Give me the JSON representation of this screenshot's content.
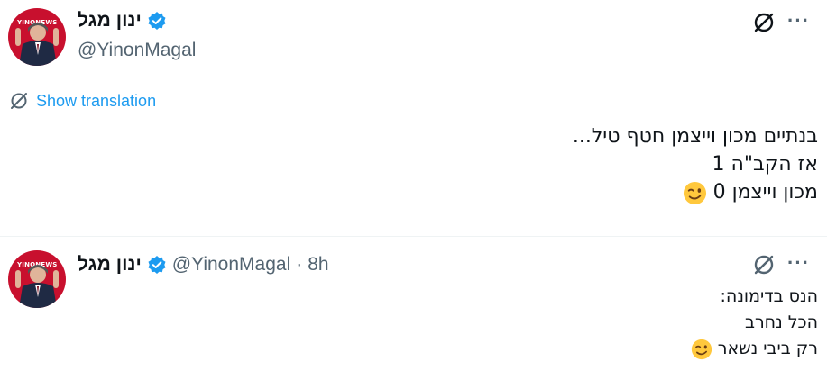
{
  "tweets": [
    {
      "display_name": "ינון מגל",
      "handle": "@YinonMagal",
      "avatar_tag": "YINONEWS",
      "more_label": "···",
      "translate_label": "Show translation",
      "lines": [
        "בנתיים מכון וייצמן חטף טיל...",
        "אז הקב\"ה 1",
        "מכון וייצמן 0"
      ]
    },
    {
      "display_name": "ינון מגל",
      "handle": "@YinonMagal",
      "separator": "·",
      "time": "8h",
      "avatar_tag": "YINONEWS",
      "more_label": "···",
      "lines": [
        "הנס בדימונה:",
        "הכל נחרב",
        "רק ביבי נשאר"
      ]
    }
  ],
  "colors": {
    "accent": "#1d9bf0",
    "text": "#0f1419",
    "secondary": "#536471",
    "avatar_bg": "#c8102e",
    "emoji": "#ffc83d"
  },
  "icons": {
    "verified": "verified-badge-icon",
    "grok": "grok-icon",
    "more": "more-icon",
    "translate": "translate-icon",
    "emoji": "winking-face-emoji"
  }
}
